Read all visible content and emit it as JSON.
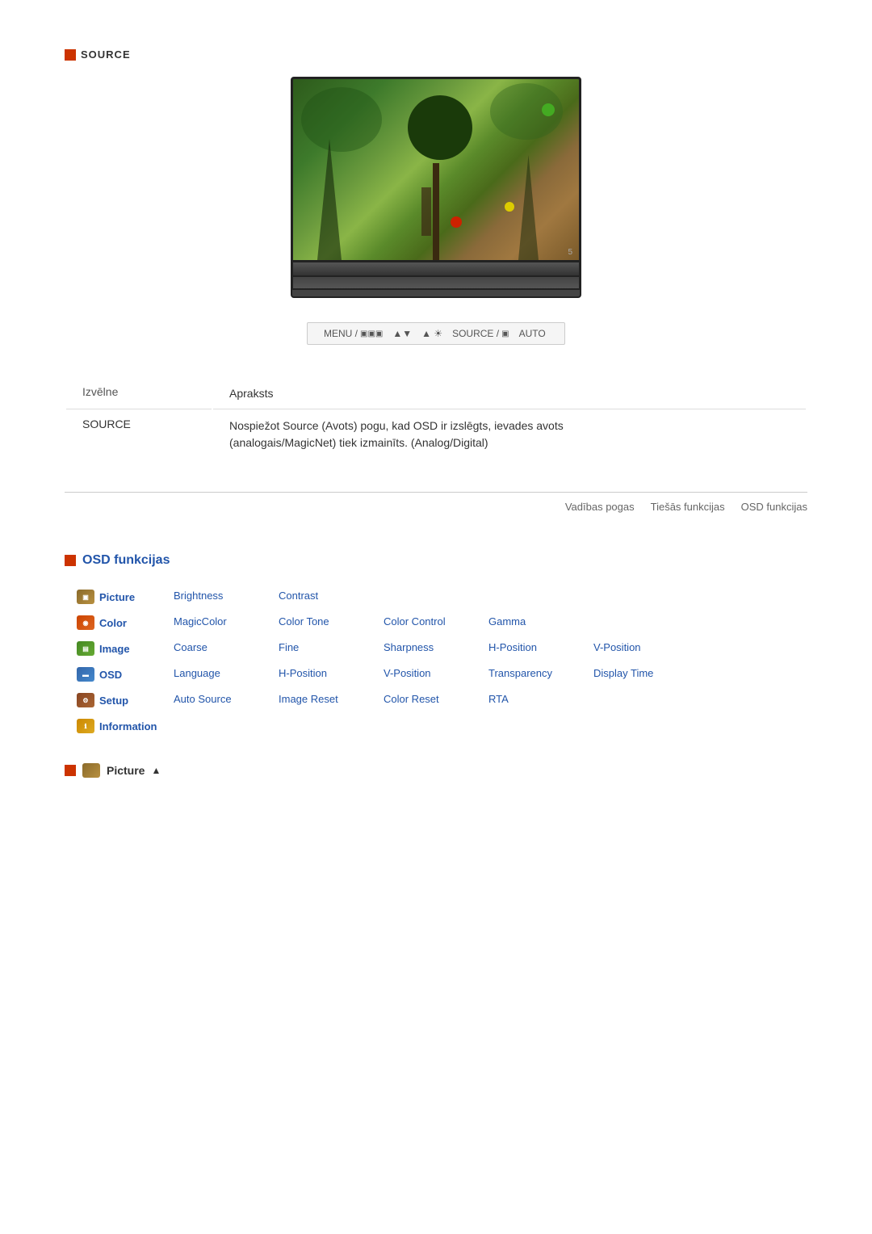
{
  "source_section": {
    "icon_label": "■",
    "title": "SOURCE"
  },
  "controls_bar": {
    "items": [
      "MENU /",
      "◄►/▼",
      "▲/☀",
      "SOURCE / ▣",
      "AUTO"
    ]
  },
  "table": {
    "col1_header": "Izvēlne",
    "col2_header": "Apraksts",
    "rows": [
      {
        "menu": "SOURCE",
        "desc": "Nospiežot Source (Avots) pogu, kad OSD ir izslēgts, ievades avots\n(analogais/MagicNet) tiek izmainīts. (Analog/Digital)"
      }
    ]
  },
  "nav_links": {
    "link1": "Vadības pogas",
    "link2": "Tiešās funkcijas",
    "link3": "OSD funkcijas"
  },
  "osd_section": {
    "title": "OSD funkcijas",
    "menu_rows": [
      {
        "category": "Picture",
        "cat_key": "picture",
        "items": [
          "Brightness",
          "Contrast",
          "",
          "",
          ""
        ]
      },
      {
        "category": "Color",
        "cat_key": "color",
        "items": [
          "MagicColor",
          "Color Tone",
          "Color Control",
          "Gamma",
          ""
        ]
      },
      {
        "category": "Image",
        "cat_key": "image",
        "items": [
          "Coarse",
          "Fine",
          "Sharpness",
          "H-Position",
          "V-Position"
        ]
      },
      {
        "category": "OSD",
        "cat_key": "osd",
        "items": [
          "Language",
          "H-Position",
          "V-Position",
          "Transparency",
          "Display Time"
        ]
      },
      {
        "category": "Setup",
        "cat_key": "setup",
        "items": [
          "Auto Source",
          "Image Reset",
          "Color Reset",
          "RTA",
          ""
        ]
      },
      {
        "category": "Information",
        "cat_key": "info",
        "items": [
          "",
          "",
          "",
          "",
          ""
        ]
      }
    ]
  },
  "picture_nav": {
    "label": "Picture"
  }
}
